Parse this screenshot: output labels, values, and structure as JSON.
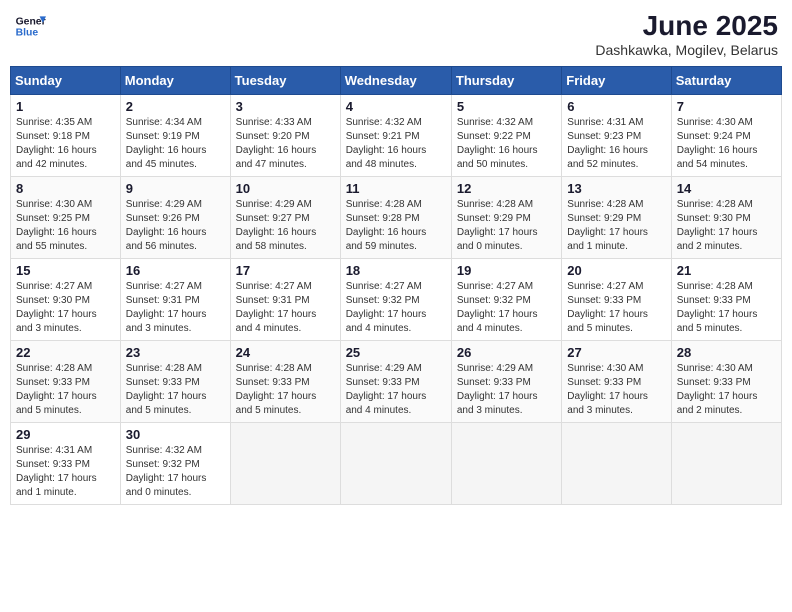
{
  "logo": {
    "line1": "General",
    "line2": "Blue"
  },
  "title": "June 2025",
  "subtitle": "Dashkawka, Mogilev, Belarus",
  "weekdays": [
    "Sunday",
    "Monday",
    "Tuesday",
    "Wednesday",
    "Thursday",
    "Friday",
    "Saturday"
  ],
  "weeks": [
    [
      {
        "day": "1",
        "info": "Sunrise: 4:35 AM\nSunset: 9:18 PM\nDaylight: 16 hours\nand 42 minutes."
      },
      {
        "day": "2",
        "info": "Sunrise: 4:34 AM\nSunset: 9:19 PM\nDaylight: 16 hours\nand 45 minutes."
      },
      {
        "day": "3",
        "info": "Sunrise: 4:33 AM\nSunset: 9:20 PM\nDaylight: 16 hours\nand 47 minutes."
      },
      {
        "day": "4",
        "info": "Sunrise: 4:32 AM\nSunset: 9:21 PM\nDaylight: 16 hours\nand 48 minutes."
      },
      {
        "day": "5",
        "info": "Sunrise: 4:32 AM\nSunset: 9:22 PM\nDaylight: 16 hours\nand 50 minutes."
      },
      {
        "day": "6",
        "info": "Sunrise: 4:31 AM\nSunset: 9:23 PM\nDaylight: 16 hours\nand 52 minutes."
      },
      {
        "day": "7",
        "info": "Sunrise: 4:30 AM\nSunset: 9:24 PM\nDaylight: 16 hours\nand 54 minutes."
      }
    ],
    [
      {
        "day": "8",
        "info": "Sunrise: 4:30 AM\nSunset: 9:25 PM\nDaylight: 16 hours\nand 55 minutes."
      },
      {
        "day": "9",
        "info": "Sunrise: 4:29 AM\nSunset: 9:26 PM\nDaylight: 16 hours\nand 56 minutes."
      },
      {
        "day": "10",
        "info": "Sunrise: 4:29 AM\nSunset: 9:27 PM\nDaylight: 16 hours\nand 58 minutes."
      },
      {
        "day": "11",
        "info": "Sunrise: 4:28 AM\nSunset: 9:28 PM\nDaylight: 16 hours\nand 59 minutes."
      },
      {
        "day": "12",
        "info": "Sunrise: 4:28 AM\nSunset: 9:29 PM\nDaylight: 17 hours\nand 0 minutes."
      },
      {
        "day": "13",
        "info": "Sunrise: 4:28 AM\nSunset: 9:29 PM\nDaylight: 17 hours\nand 1 minute."
      },
      {
        "day": "14",
        "info": "Sunrise: 4:28 AM\nSunset: 9:30 PM\nDaylight: 17 hours\nand 2 minutes."
      }
    ],
    [
      {
        "day": "15",
        "info": "Sunrise: 4:27 AM\nSunset: 9:30 PM\nDaylight: 17 hours\nand 3 minutes."
      },
      {
        "day": "16",
        "info": "Sunrise: 4:27 AM\nSunset: 9:31 PM\nDaylight: 17 hours\nand 3 minutes."
      },
      {
        "day": "17",
        "info": "Sunrise: 4:27 AM\nSunset: 9:31 PM\nDaylight: 17 hours\nand 4 minutes."
      },
      {
        "day": "18",
        "info": "Sunrise: 4:27 AM\nSunset: 9:32 PM\nDaylight: 17 hours\nand 4 minutes."
      },
      {
        "day": "19",
        "info": "Sunrise: 4:27 AM\nSunset: 9:32 PM\nDaylight: 17 hours\nand 4 minutes."
      },
      {
        "day": "20",
        "info": "Sunrise: 4:27 AM\nSunset: 9:33 PM\nDaylight: 17 hours\nand 5 minutes."
      },
      {
        "day": "21",
        "info": "Sunrise: 4:28 AM\nSunset: 9:33 PM\nDaylight: 17 hours\nand 5 minutes."
      }
    ],
    [
      {
        "day": "22",
        "info": "Sunrise: 4:28 AM\nSunset: 9:33 PM\nDaylight: 17 hours\nand 5 minutes."
      },
      {
        "day": "23",
        "info": "Sunrise: 4:28 AM\nSunset: 9:33 PM\nDaylight: 17 hours\nand 5 minutes."
      },
      {
        "day": "24",
        "info": "Sunrise: 4:28 AM\nSunset: 9:33 PM\nDaylight: 17 hours\nand 5 minutes."
      },
      {
        "day": "25",
        "info": "Sunrise: 4:29 AM\nSunset: 9:33 PM\nDaylight: 17 hours\nand 4 minutes."
      },
      {
        "day": "26",
        "info": "Sunrise: 4:29 AM\nSunset: 9:33 PM\nDaylight: 17 hours\nand 3 minutes."
      },
      {
        "day": "27",
        "info": "Sunrise: 4:30 AM\nSunset: 9:33 PM\nDaylight: 17 hours\nand 3 minutes."
      },
      {
        "day": "28",
        "info": "Sunrise: 4:30 AM\nSunset: 9:33 PM\nDaylight: 17 hours\nand 2 minutes."
      }
    ],
    [
      {
        "day": "29",
        "info": "Sunrise: 4:31 AM\nSunset: 9:33 PM\nDaylight: 17 hours\nand 1 minute."
      },
      {
        "day": "30",
        "info": "Sunrise: 4:32 AM\nSunset: 9:32 PM\nDaylight: 17 hours\nand 0 minutes."
      },
      {
        "day": "",
        "info": ""
      },
      {
        "day": "",
        "info": ""
      },
      {
        "day": "",
        "info": ""
      },
      {
        "day": "",
        "info": ""
      },
      {
        "day": "",
        "info": ""
      }
    ]
  ]
}
